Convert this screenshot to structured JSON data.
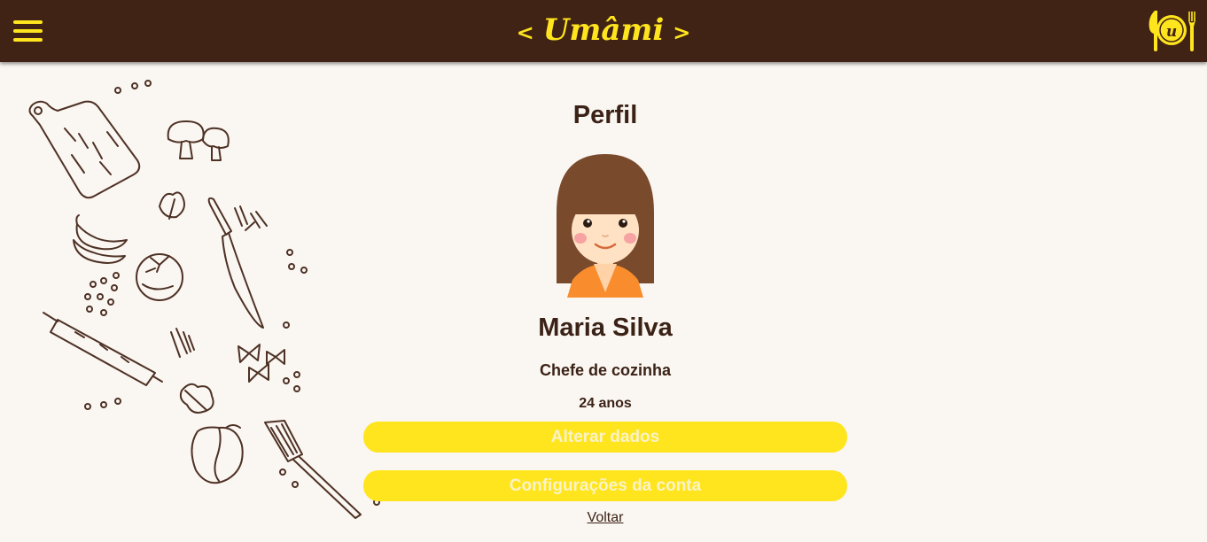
{
  "header": {
    "brand": "Umâmi",
    "prev_arrow": "<",
    "next_arrow": ">",
    "menu_icon": "hamburger-menu-icon",
    "logo": "umami-plate-cutlery-logo"
  },
  "colors": {
    "header_bg": "#402314",
    "accent": "#ffe51e",
    "page_bg": "#faf6f1",
    "text": "#3b2216"
  },
  "decoration": {
    "illustration": "kitchen-utensils-vegetables-doodles"
  },
  "profile": {
    "title": "Perfil",
    "avatar": "girl-avatar",
    "name": "Maria Silva",
    "role": "Chefe de cozinha",
    "age": "24 anos"
  },
  "actions": {
    "edit_label": "Alterar dados",
    "settings_label": "Configurações da conta",
    "back_label": "Voltar"
  }
}
